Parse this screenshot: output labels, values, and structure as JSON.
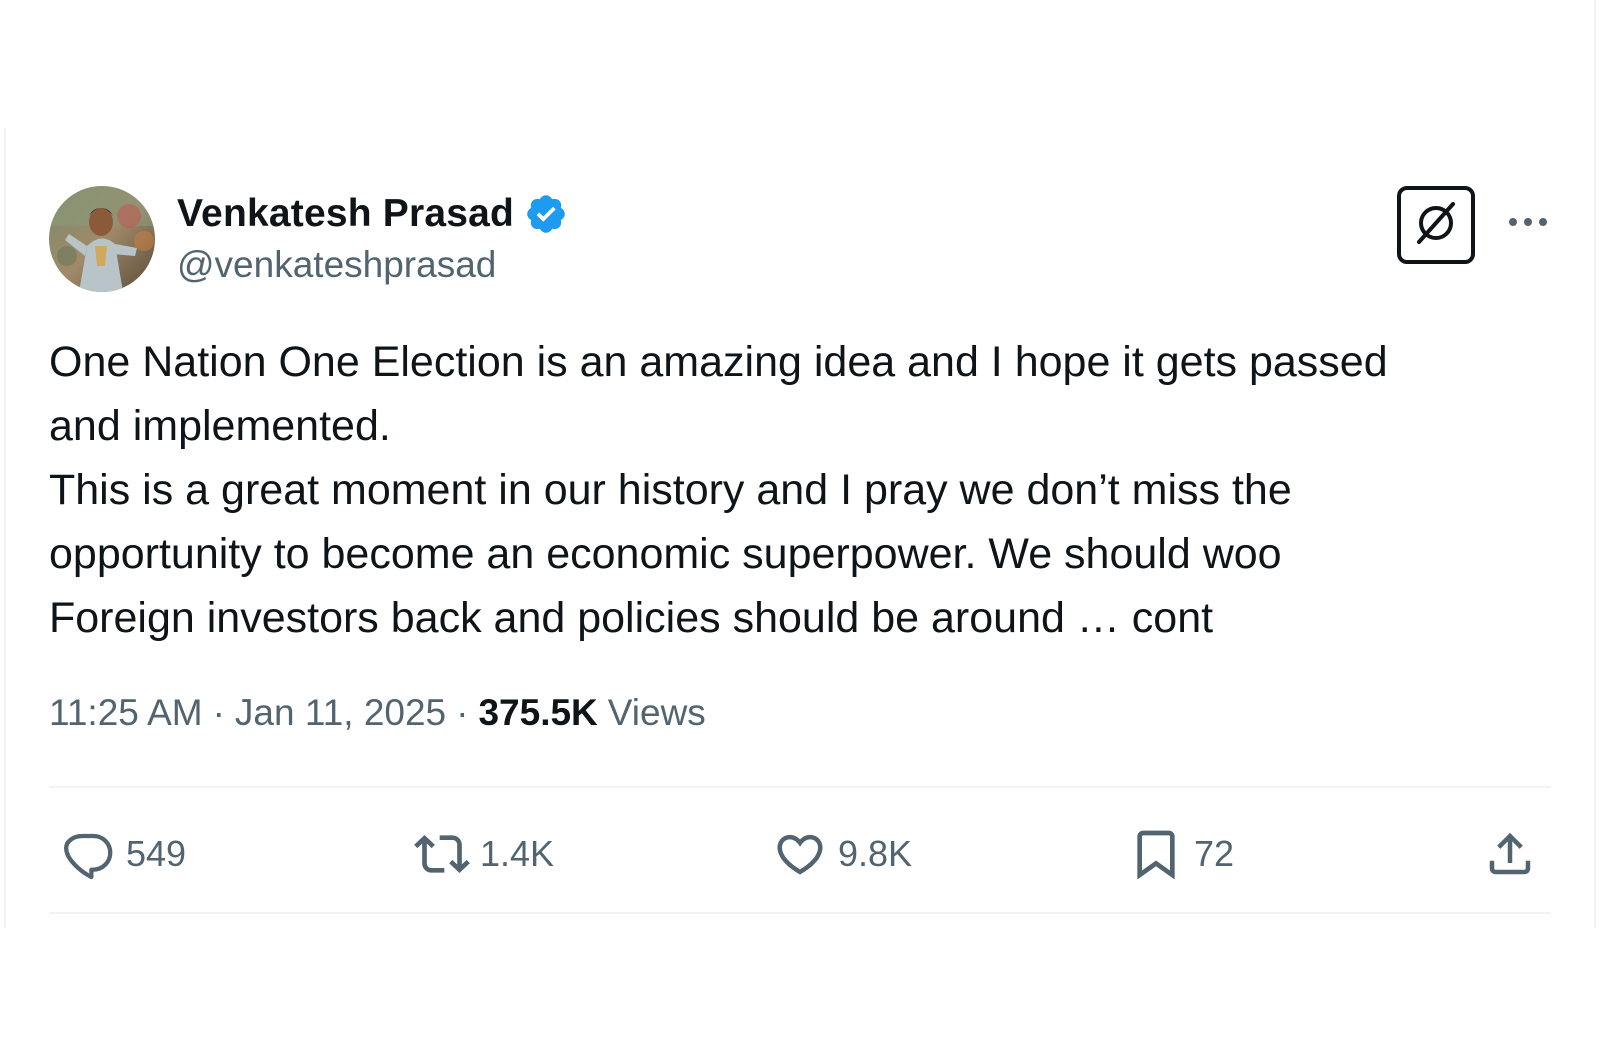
{
  "author": {
    "display_name": "Venkatesh Prasad",
    "handle": "@venkateshprasad",
    "verified": true,
    "avatar": "profile-photo"
  },
  "header_actions": {
    "grok_icon": "grok-icon",
    "more_icon": "more-horizontal-icon"
  },
  "tweet": {
    "lines": [
      "One Nation One Election is an amazing idea and I hope it gets passed",
      "and implemented.",
      "This is a great moment in our history and I pray we don’t miss the",
      "opportunity to become an economic superpower. We should woo",
      "Foreign investors back and policies should be around … cont"
    ]
  },
  "meta": {
    "time": "11:25 AM",
    "date": "Jan 11, 2025",
    "separator": "·",
    "views_count": "375.5K",
    "views_label": "Views"
  },
  "actions": {
    "reply": {
      "icon": "reply-icon",
      "count": "549"
    },
    "repost": {
      "icon": "repost-icon",
      "count": "1.4K"
    },
    "like": {
      "icon": "like-icon",
      "count": "9.8K"
    },
    "bookmark": {
      "icon": "bookmark-icon",
      "count": "72"
    },
    "share": {
      "icon": "share-icon"
    }
  },
  "colors": {
    "text_primary": "#0f1419",
    "text_secondary": "#536471",
    "verified_blue": "#1d9bf0",
    "divider": "#eff3f4"
  }
}
